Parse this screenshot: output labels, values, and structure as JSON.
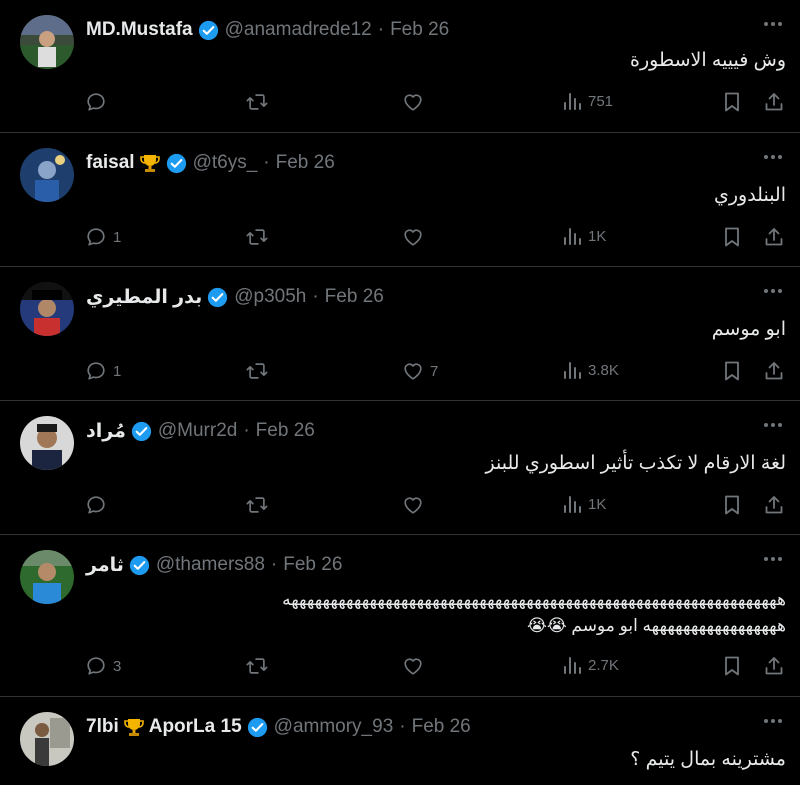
{
  "tweets": [
    {
      "name": "MD.Mustafa",
      "trophy": false,
      "handle": "@anamadrede12",
      "date": "Feb 26",
      "text": [
        "وش فيييه الاسطورة"
      ],
      "replies": "",
      "likes": "",
      "views": "751"
    },
    {
      "name": "faisal",
      "trophy": true,
      "handle": "@t6ys_",
      "date": "Feb 26",
      "text": [
        "البنلدوري"
      ],
      "replies": "1",
      "likes": "",
      "views": "1K"
    },
    {
      "name": "بدر المطيري",
      "trophy": false,
      "handle": "@p305h",
      "date": "Feb 26",
      "text": [
        "ابو موسم"
      ],
      "replies": "1",
      "likes": "7",
      "views": "3.8K"
    },
    {
      "name": "مُراد",
      "trophy": false,
      "handle": "@Murr2d",
      "date": "Feb 26",
      "text": [
        "لغة الارقام لا تكذب تأثير اسطوري للبنز"
      ],
      "replies": "",
      "likes": "",
      "views": "1K"
    },
    {
      "name": "ثامر",
      "trophy": false,
      "handle": "@thamers88",
      "date": "Feb 26",
      "text": [
        "هههههههههههههههههههههههههههههههههههههههههههههههههههههههههههههههه",
        "هههههههههههههههههه ابو موسم 😭😭"
      ],
      "replies": "3",
      "likes": "",
      "views": "2.7K"
    },
    {
      "name": "7lbi",
      "name2": "AporLa 15",
      "trophy": true,
      "handle": "@ammory_93",
      "date": "Feb 26",
      "text": [
        "مشترينه بمال يتيم ؟"
      ],
      "replies": "",
      "likes": "",
      "views": ""
    }
  ],
  "icons": {
    "reply": "reply-icon",
    "retweet": "retweet-icon",
    "like": "like-icon",
    "views": "views-icon",
    "bookmark": "bookmark-icon",
    "share": "share-icon",
    "verified": "verified-badge-icon",
    "trophy": "trophy-emoji-icon",
    "more": "more-options-icon"
  },
  "colors": {
    "background": "#000000",
    "text": "#e7e9ea",
    "muted": "#71767b",
    "verified": "#1d9bf0",
    "border": "#2f3336"
  }
}
